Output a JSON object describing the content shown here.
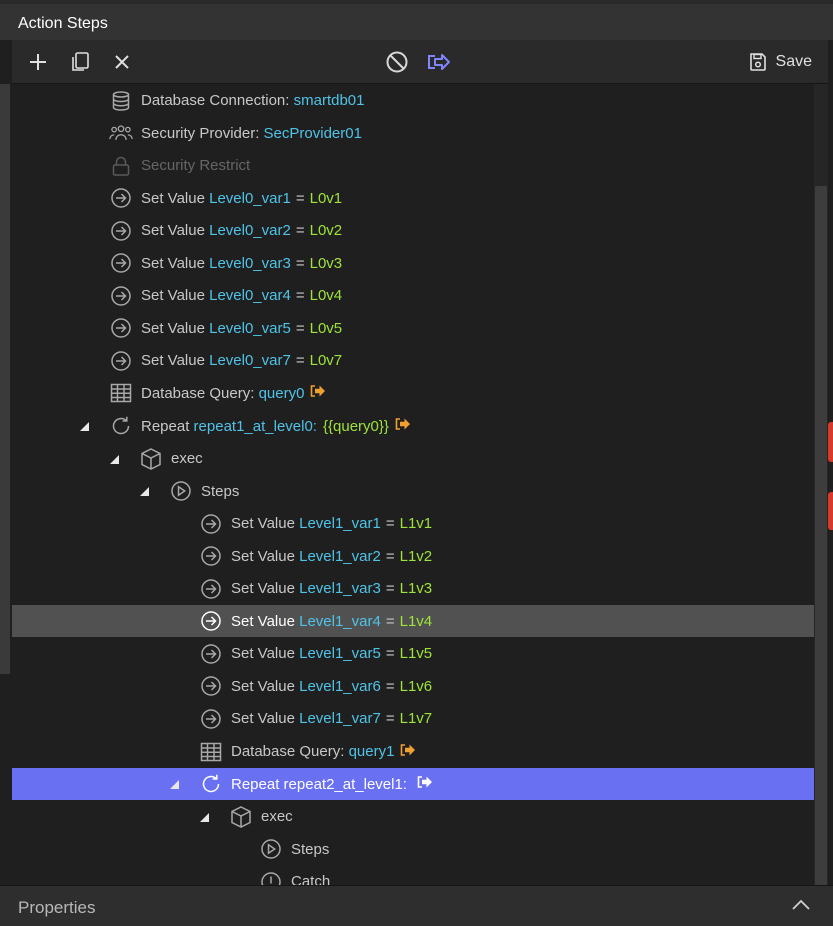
{
  "window": {
    "title": "Action Steps"
  },
  "toolbar": {
    "add_icon": "plus-icon",
    "copy_icon": "copy-icon",
    "delete_icon": "close-icon",
    "disable_icon": "disable-icon",
    "goto_icon": "goto-icon",
    "save_label": "Save",
    "accent_color": "#6a70f2"
  },
  "tree": {
    "rows": [
      {
        "level": 0,
        "icon": "database-icon",
        "text": "Database Connection: ",
        "name": "smartdb01"
      },
      {
        "level": 0,
        "icon": "users-icon",
        "text": "Security Provider: ",
        "name": "SecProvider01"
      },
      {
        "level": 0,
        "icon": "lock-icon",
        "text": "Security Restrict",
        "disabled": true
      },
      {
        "level": 0,
        "icon": "set-value-icon",
        "text": "Set Value ",
        "name": "Level0_var1",
        "eq": "=",
        "value": "L0v1"
      },
      {
        "level": 0,
        "icon": "set-value-icon",
        "text": "Set Value ",
        "name": "Level0_var2",
        "eq": "=",
        "value": "L0v2"
      },
      {
        "level": 0,
        "icon": "set-value-icon",
        "text": "Set Value ",
        "name": "Level0_var3",
        "eq": "=",
        "value": "L0v3"
      },
      {
        "level": 0,
        "icon": "set-value-icon",
        "text": "Set Value ",
        "name": "Level0_var4",
        "eq": "=",
        "value": "L0v4"
      },
      {
        "level": 0,
        "icon": "set-value-icon",
        "text": "Set Value ",
        "name": "Level0_var5",
        "eq": "=",
        "value": "L0v5"
      },
      {
        "level": 0,
        "icon": "set-value-icon",
        "text": "Set Value ",
        "name": "Level0_var7",
        "eq": "=",
        "value": "L0v7"
      },
      {
        "level": 0,
        "icon": "table-icon",
        "text": "Database Query: ",
        "name": "query0",
        "goto": true
      },
      {
        "level": 0,
        "icon": "repeat-icon",
        "text": "Repeat ",
        "name": "repeat1_at_level0:",
        "value": "{{query0}}",
        "goto": true,
        "expanded": true
      },
      {
        "level": 1,
        "icon": "box-icon",
        "text": "exec",
        "expanded": true
      },
      {
        "level": 2,
        "icon": "play-icon",
        "text": "Steps",
        "expanded": true
      },
      {
        "level": 3,
        "icon": "set-value-icon",
        "text": "Set Value ",
        "name": "Level1_var1",
        "eq": "=",
        "value": "L1v1"
      },
      {
        "level": 3,
        "icon": "set-value-icon",
        "text": "Set Value ",
        "name": "Level1_var2",
        "eq": "=",
        "value": "L1v2"
      },
      {
        "level": 3,
        "icon": "set-value-icon",
        "text": "Set Value ",
        "name": "Level1_var3",
        "eq": "=",
        "value": "L1v3"
      },
      {
        "level": 3,
        "icon": "set-value-icon",
        "text": "Set Value ",
        "name": "Level1_var4",
        "eq": "=",
        "value": "L1v4",
        "selected": true
      },
      {
        "level": 3,
        "icon": "set-value-icon",
        "text": "Set Value ",
        "name": "Level1_var5",
        "eq": "=",
        "value": "L1v5"
      },
      {
        "level": 3,
        "icon": "set-value-icon",
        "text": "Set Value ",
        "name": "Level1_var6",
        "eq": "=",
        "value": "L1v6"
      },
      {
        "level": 3,
        "icon": "set-value-icon",
        "text": "Set Value ",
        "name": "Level1_var7",
        "eq": "=",
        "value": "L1v7"
      },
      {
        "level": 3,
        "icon": "table-icon",
        "text": "Database Query: ",
        "name": "query1",
        "goto": true
      },
      {
        "level": 3,
        "icon": "repeat-icon",
        "text": "Repeat ",
        "name": "repeat2_at_level1:",
        "goto": true,
        "expanded": true,
        "active": true
      },
      {
        "level": 4,
        "icon": "box-icon",
        "text": "exec",
        "expanded": true
      },
      {
        "level": 5,
        "icon": "play-icon",
        "text": "Steps"
      },
      {
        "level": 5,
        "icon": "alert-icon",
        "text": "Catch"
      }
    ]
  },
  "properties": {
    "label": "Properties",
    "chevron_icon": "chevron-up-icon"
  },
  "colors": {
    "variable": "#4fc3e8",
    "value": "#9ee33a",
    "goto": "#f0a030",
    "selected_row": "#515151",
    "active_row": "#6a70f2"
  }
}
